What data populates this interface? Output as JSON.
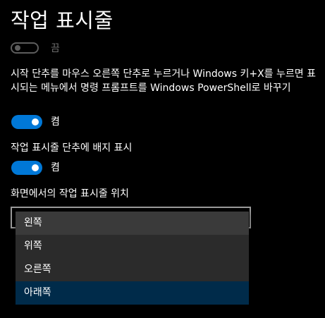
{
  "page_title": "작업 표시줄",
  "toggle1": {
    "state_label": "끔",
    "on": false
  },
  "description1": "시작 단추를 마우스 오른쪽 단추로 누르거나 Windows 키+X를 누르면 표시되는 메뉴에서 명령 프롬프트를 Windows PowerShell로 바꾸기",
  "toggle2": {
    "state_label": "켬",
    "on": true
  },
  "description2": "작업 표시줄 단추에 배지 표시",
  "toggle3": {
    "state_label": "켬",
    "on": true
  },
  "position_label": "화면에서의 작업 표시줄 위치",
  "position_dropdown": {
    "options": [
      "왼쪽",
      "위쪽",
      "오른쪽",
      "아래쪽"
    ],
    "selected": "아래쪽"
  },
  "colors": {
    "accent": "#0078d7",
    "selected_item": "#002b4a",
    "menu_bg": "#2b2b2b"
  }
}
